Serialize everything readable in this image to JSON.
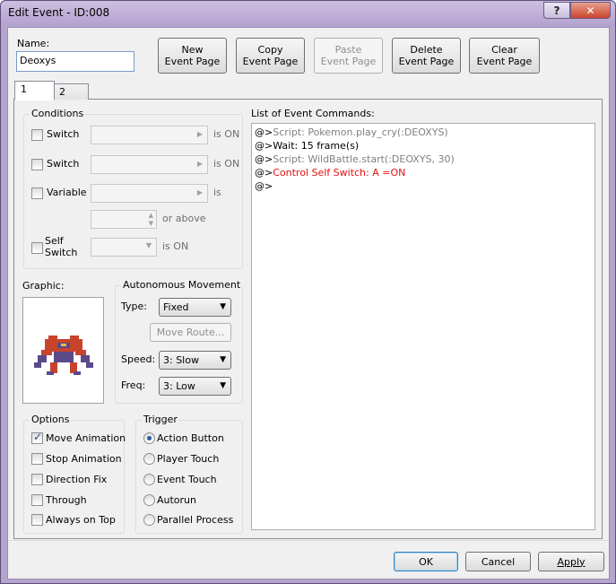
{
  "window": {
    "title": "Edit Event - ID:008",
    "help_glyph": "?",
    "close_glyph": "✕"
  },
  "name": {
    "label": "Name:",
    "value": "Deoxys"
  },
  "toolbar": [
    {
      "line1": "New",
      "line2": "Event Page",
      "enabled": true
    },
    {
      "line1": "Copy",
      "line2": "Event Page",
      "enabled": true
    },
    {
      "line1": "Paste",
      "line2": "Event Page",
      "enabled": false
    },
    {
      "line1": "Delete",
      "line2": "Event Page",
      "enabled": true
    },
    {
      "line1": "Clear",
      "line2": "Event Page",
      "enabled": true
    }
  ],
  "tabs": [
    "1",
    "2"
  ],
  "conditions": {
    "title": "Conditions",
    "switch1": {
      "label": "Switch",
      "suffix": "is ON",
      "checked": false
    },
    "switch2": {
      "label": "Switch",
      "suffix": "is ON",
      "checked": false
    },
    "variable": {
      "label": "Variable",
      "suffix": "is",
      "or_above": "or above",
      "checked": false
    },
    "self_switch": {
      "label_line1": "Self",
      "label_line2": "Switch",
      "suffix": "is ON",
      "checked": false
    }
  },
  "graphic": {
    "label": "Graphic:"
  },
  "movement": {
    "title": "Autonomous Movement",
    "type_label": "Type:",
    "type_value": "Fixed",
    "move_route": "Move Route...",
    "speed_label": "Speed:",
    "speed_value": "3: Slow",
    "freq_label": "Freq:",
    "freq_value": "3: Low"
  },
  "options": {
    "title": "Options",
    "items": [
      {
        "label": "Move Animation",
        "checked": true
      },
      {
        "label": "Stop Animation",
        "checked": false
      },
      {
        "label": "Direction Fix",
        "checked": false
      },
      {
        "label": "Through",
        "checked": false
      },
      {
        "label": "Always on Top",
        "checked": false
      }
    ]
  },
  "trigger": {
    "title": "Trigger",
    "items": [
      {
        "label": "Action Button",
        "checked": true
      },
      {
        "label": "Player Touch",
        "checked": false
      },
      {
        "label": "Event Touch",
        "checked": false
      },
      {
        "label": "Autorun",
        "checked": false
      },
      {
        "label": "Parallel Process",
        "checked": false
      }
    ]
  },
  "commands": {
    "label": "List of Event Commands:",
    "items": [
      {
        "prefix": "@>",
        "text": "Script: Pokemon.play_cry(:DEOXYS)",
        "color": "#808080"
      },
      {
        "prefix": "@>",
        "text": "Wait: 15 frame(s)",
        "color": "#000000"
      },
      {
        "prefix": "@>",
        "text": "Script: WildBattle.start(:DEOXYS, 30)",
        "color": "#808080"
      },
      {
        "prefix": "@>",
        "text": "Control Self Switch: A =ON",
        "color": "#e01010"
      },
      {
        "prefix": "@>",
        "text": "",
        "color": "#000000"
      }
    ]
  },
  "footer": {
    "ok": "OK",
    "cancel": "Cancel",
    "apply": "Apply"
  },
  "colors": {
    "frame": "#b6a4cf",
    "dialog": "#f0f0f0",
    "sprite_body": "#c8432b",
    "sprite_dark": "#5a4a8a"
  }
}
